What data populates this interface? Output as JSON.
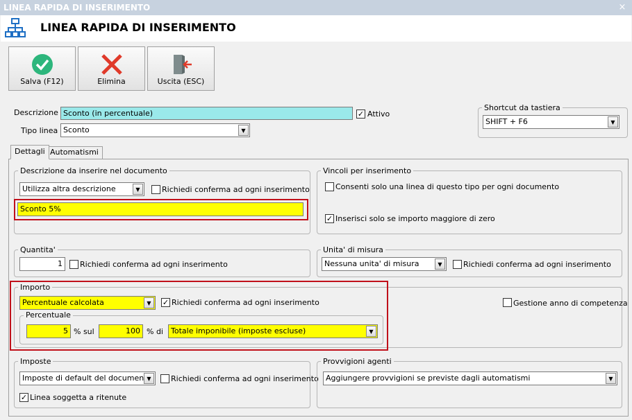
{
  "window": {
    "title": "LINEA RAPIDA DI INSERIMENTO",
    "close": "×"
  },
  "header": {
    "title": "LINEA RAPIDA DI INSERIMENTO"
  },
  "toolbar": {
    "save": "Salva (F12)",
    "delete": "Elimina",
    "exit": "Uscita (ESC)"
  },
  "form": {
    "descrizione_label": "Descrizione :",
    "descrizione_value": "Sconto (in percentuale)",
    "attivo_label": "Attivo",
    "attivo_checked": true,
    "tipo_label": "Tipo linea :",
    "tipo_value": "Sconto"
  },
  "shortcut": {
    "label": "Shortcut da tastiera",
    "value": "SHIFT + F6"
  },
  "tabs": [
    "Dettagli",
    "Automatismi"
  ],
  "descrizione_doc": {
    "label": "Descrizione da inserire nel documento",
    "combo": "Utilizza altra descrizione",
    "confirm": "Richiedi conferma ad ogni inserimento",
    "text": "Sconto 5%"
  },
  "vincoli": {
    "label": "Vincoli per inserimento",
    "one_line": "Consenti solo una linea di questo tipo per ogni documento",
    "one_line_checked": false,
    "positive": "Inserisci solo se importo maggiore di zero",
    "positive_checked": true
  },
  "quantita": {
    "label": "Quantita'",
    "value": "1",
    "confirm": "Richiedi conferma ad ogni inserimento"
  },
  "unita": {
    "label": "Unita' di misura",
    "combo": "Nessuna unita' di misura",
    "confirm": "Richiedi conferma ad ogni inserimento"
  },
  "importo": {
    "label": "Importo",
    "combo": "Percentuale calcolata",
    "confirm": "Richiedi conferma ad ogni inserimento",
    "confirm_checked": true,
    "gestione": "Gestione anno di competenza",
    "percentuale_label": "Percentuale",
    "perc_value": "5",
    "sul_label": "% sul",
    "base_value": "100",
    "di_label": "% di",
    "base_combo": "Totale imponibile (imposte escluse)"
  },
  "imposte": {
    "label": "Imposte",
    "combo": "Imposte di default del documento",
    "confirm": "Richiedi conferma ad ogni inserimento",
    "ritenute": "Linea soggetta a ritenute",
    "ritenute_checked": true
  },
  "provvigioni": {
    "label": "Provvigioni agenti",
    "combo": "Aggiungere provvigioni se previste dagli automatismi"
  },
  "colors": {
    "highlight": "#ffff00",
    "description_bg": "#9ae9ea",
    "callout": "#c0101a"
  }
}
